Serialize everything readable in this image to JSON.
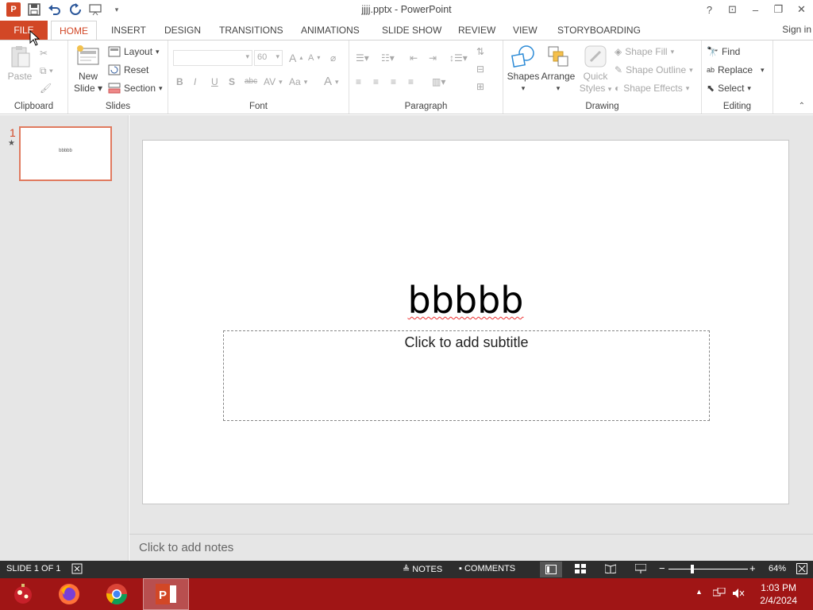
{
  "window": {
    "title": "jjjj.pptx - PowerPoint",
    "help": "?",
    "minimize": "–",
    "restore": "❐",
    "close": "✕",
    "ribbon_display": "⊡"
  },
  "tabs": {
    "file": "FILE",
    "items": [
      "HOME",
      "INSERT",
      "DESIGN",
      "TRANSITIONS",
      "ANIMATIONS",
      "SLIDE SHOW",
      "REVIEW",
      "VIEW",
      "STORYBOARDING"
    ],
    "active": "HOME",
    "sign_in": "Sign in"
  },
  "ribbon": {
    "clipboard": {
      "label": "Clipboard",
      "paste": "Paste"
    },
    "slides": {
      "label": "Slides",
      "new_slide_line1": "New",
      "new_slide_line2": "Slide",
      "layout": "Layout",
      "reset": "Reset",
      "section": "Section"
    },
    "font": {
      "label": "Font",
      "size": "60",
      "bold": "B",
      "italic": "I",
      "underline": "U",
      "shadow": "S",
      "strike": "abc",
      "spacing": "AV",
      "case": "Aa",
      "color": "A"
    },
    "paragraph": {
      "label": "Paragraph"
    },
    "drawing": {
      "label": "Drawing",
      "shapes": "Shapes",
      "arrange": "Arrange",
      "quick_styles_1": "Quick",
      "quick_styles_2": "Styles",
      "shape_fill": "Shape Fill",
      "shape_outline": "Shape Outline",
      "shape_effects": "Shape Effects"
    },
    "editing": {
      "label": "Editing",
      "find": "Find",
      "replace": "Replace",
      "select": "Select"
    }
  },
  "slides_pane": {
    "number": "1",
    "star": "★",
    "thumb_text": "bbbbb"
  },
  "slide": {
    "title": "bbbbb",
    "subtitle_placeholder": "Click to add subtitle"
  },
  "notes": {
    "placeholder": "Click to add notes"
  },
  "status": {
    "slide_info": "SLIDE 1 OF 1",
    "notes": "NOTES",
    "comments": "COMMENTS",
    "zoom": "64%",
    "zoom_minus": "−",
    "zoom_plus": "+"
  },
  "taskbar": {
    "time": "1:03 PM",
    "date": "2/4/2024"
  },
  "colors": {
    "accent": "#d24726",
    "taskbar": "#a01515",
    "statusbar": "#2d2d2d"
  }
}
